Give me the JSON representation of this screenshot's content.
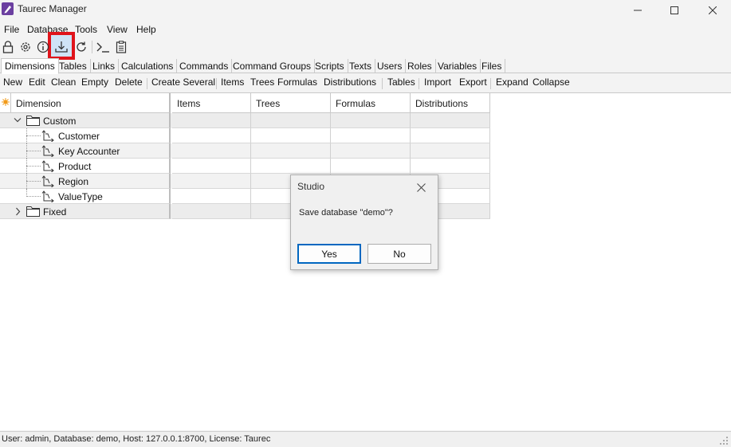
{
  "window": {
    "title": "Taurec Manager"
  },
  "menu": [
    "File",
    "Database",
    "Tools",
    "View",
    "Help"
  ],
  "toolbar_icons": [
    "lock-icon",
    "gear-icon",
    "info-icon",
    "save-database-icon",
    "refresh-icon",
    "console-icon",
    "notes-icon"
  ],
  "tabs": [
    "Dimensions",
    "Tables",
    "Links",
    "Calculations",
    "Commands",
    "Command Groups",
    "Scripts",
    "Texts",
    "Users",
    "Roles",
    "Variables",
    "Files"
  ],
  "actions": {
    "group1": [
      "New",
      "Edit",
      "Clean",
      "Empty",
      "Delete"
    ],
    "group2": [
      "Create Several"
    ],
    "group3": [
      "Items",
      "Trees",
      "Formulas",
      "Distributions"
    ],
    "group4": [
      "Tables"
    ],
    "group5": [
      "Import",
      "Export"
    ],
    "group6": [
      "Expand",
      "Collapse"
    ]
  },
  "grid": {
    "columns": [
      "Dimension",
      "Items",
      "Trees",
      "Formulas",
      "Distributions"
    ],
    "rows": [
      {
        "label": "Custom",
        "type": "folder",
        "expanded": true
      },
      {
        "label": "Customer",
        "type": "dimension"
      },
      {
        "label": "Key Accounter",
        "type": "dimension"
      },
      {
        "label": "Product",
        "type": "dimension"
      },
      {
        "label": "Region",
        "type": "dimension"
      },
      {
        "label": "ValueType",
        "type": "dimension"
      },
      {
        "label": "Fixed",
        "type": "folder",
        "expanded": false
      }
    ]
  },
  "dialog": {
    "title": "Studio",
    "message": "Save database \"demo\"?",
    "yes": "Yes",
    "no": "No"
  },
  "status": "User: admin, Database: demo, Host: 127.0.0.1:8700, License: Taurec",
  "colors": {
    "highlight": "#e0141b",
    "app_icon": "#6b3fa0",
    "focus_button": "#0067c0"
  }
}
